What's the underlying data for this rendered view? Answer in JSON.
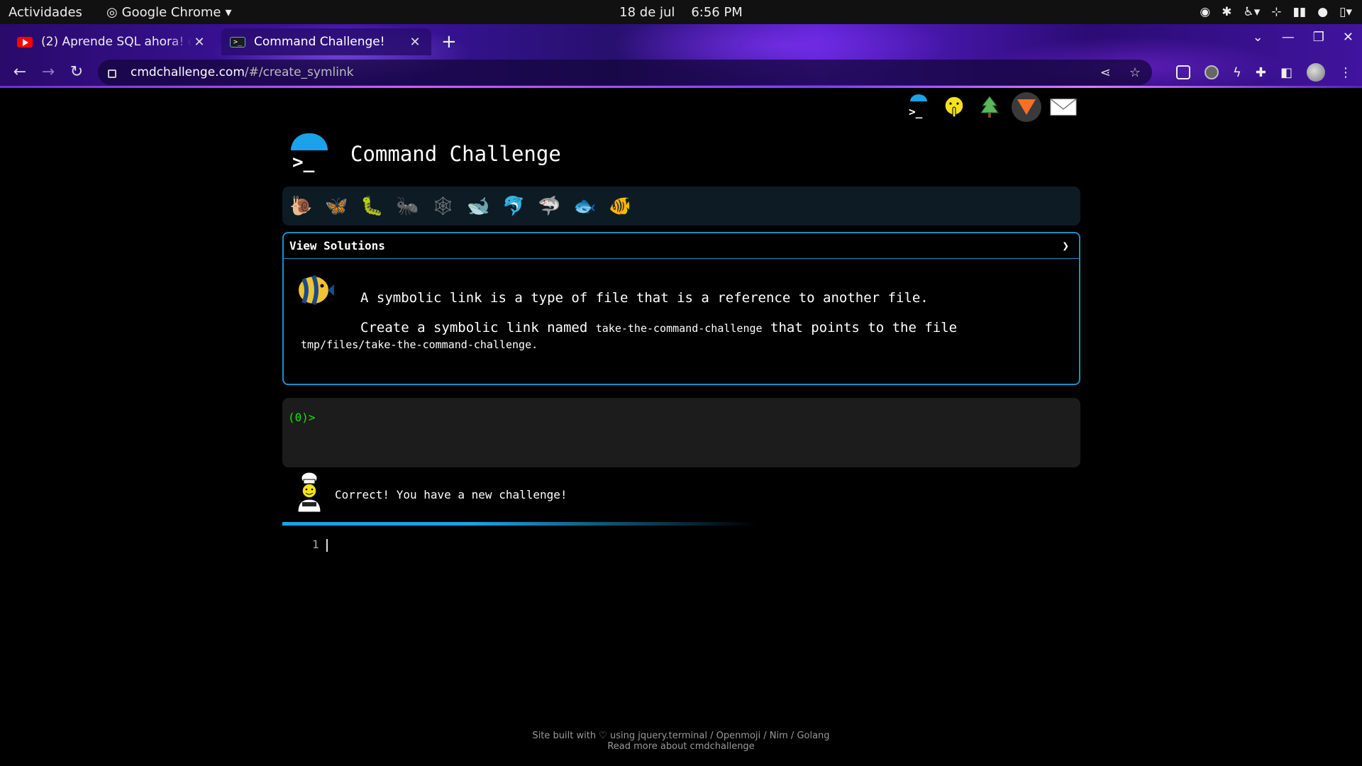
{
  "system_bar": {
    "activities": "Actividades",
    "app_name": "Google Chrome",
    "date": "18 de jul",
    "time": "6:56 PM"
  },
  "browser": {
    "tabs": [
      {
        "title": "(2) Aprende SQL ahora! c",
        "favicon": "youtube-icon",
        "active": false
      },
      {
        "title": "Command Challenge!",
        "favicon": "terminal-icon",
        "active": true
      }
    ],
    "url_host": "cmdchallenge.com",
    "url_path": "/#/create_symlink"
  },
  "site": {
    "title": "Command Challenge",
    "social_icons": [
      "terminal-icon",
      "shushing-face-icon",
      "tree-icon",
      "gitlab-icon",
      "mail-icon"
    ],
    "challenge_icons": [
      "snail-icon",
      "butterfly-icon",
      "caterpillar-icon",
      "ant-icon",
      "spider-web-icon",
      "whale-icon",
      "dolphin-icon",
      "shark-icon",
      "fish-icon",
      "tropical-fish-icon"
    ]
  },
  "solutions": {
    "header": "View Solutions",
    "chevron": "❯",
    "text_1": "A symbolic link is a type of file that is a reference to another file.",
    "text_2a": "Create a symbolic link named",
    "code_1": "take-the-command-challenge",
    "text_2b": "that points to the file",
    "code_2": "tmp/files/take-the-command-challenge",
    "text_2c": "."
  },
  "terminal": {
    "prompt": "(0)>"
  },
  "feedback": {
    "message": "Correct! You have a new challenge!"
  },
  "editor": {
    "line_number": "1"
  },
  "progress": {
    "fraction": 0.4
  },
  "footer": {
    "line1": "Site built with ♡ using jquery.terminal / Openmoji / Nim / Golang",
    "line2": "Read more about cmdchallenge"
  },
  "colors": {
    "accent": "#1a8fc8",
    "prompt_green": "#18e218",
    "terminal_bg": "#1c1c1c",
    "toolbar_purple": "#3d14a4"
  }
}
